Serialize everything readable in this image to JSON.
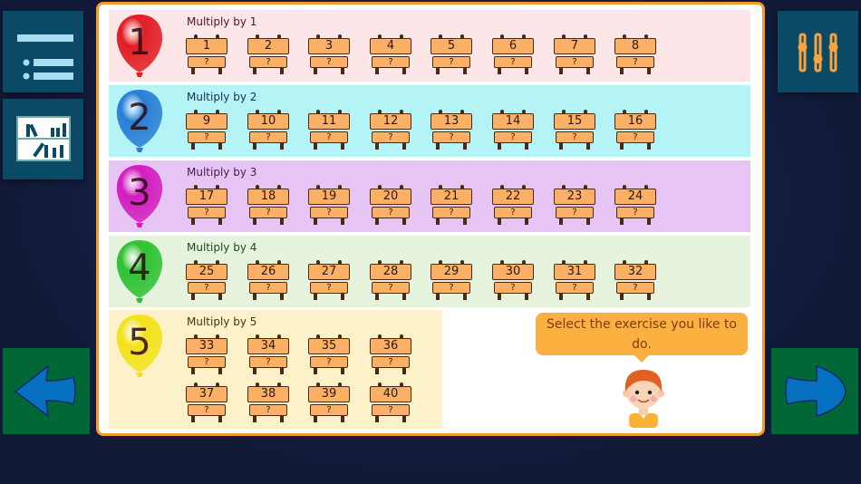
{
  "left_toolbar": {
    "menu_icon": "list-icon",
    "stats_icon": "bookshelf-icon"
  },
  "right_toolbar": {
    "settings_icon": "sliders-icon"
  },
  "nav": {
    "back_icon": "arrow-left-icon",
    "next_icon": "arrow-right-icon"
  },
  "rows": [
    {
      "balloon": "1",
      "label": "Multiply by 1",
      "color": "#e01e25",
      "bg": "#fde6e7",
      "text_color": "#5a1020",
      "exercises": [
        "1",
        "2",
        "3",
        "4",
        "5",
        "6",
        "7",
        "8"
      ]
    },
    {
      "balloon": "2",
      "label": "Multiply by 2",
      "color": "#2a7fd6",
      "bg": "#b4f4f6",
      "text_color": "#13304f",
      "exercises": [
        "9",
        "10",
        "11",
        "12",
        "13",
        "14",
        "15",
        "16"
      ]
    },
    {
      "balloon": "3",
      "label": "Multiply by 3",
      "color": "#d21fc0",
      "bg": "#e6c4f4",
      "text_color": "#4a1850",
      "exercises": [
        "17",
        "18",
        "19",
        "20",
        "21",
        "22",
        "23",
        "24"
      ]
    },
    {
      "balloon": "4",
      "label": "Multiply by 4",
      "color": "#2ec233",
      "bg": "#e6f4de",
      "text_color": "#1f4a1a",
      "exercises": [
        "25",
        "26",
        "27",
        "28",
        "29",
        "30",
        "31",
        "32"
      ]
    },
    {
      "balloon": "5",
      "label": "Multiply by 5",
      "color": "#f2e21c",
      "bg": "#fcf1c9",
      "text_color": "#4a3410",
      "exercises": [
        "33",
        "34",
        "35",
        "36",
        "37",
        "38",
        "39",
        "40"
      ]
    }
  ],
  "sign_answer": "?",
  "bubble_text": "Select the exercise you like to do."
}
